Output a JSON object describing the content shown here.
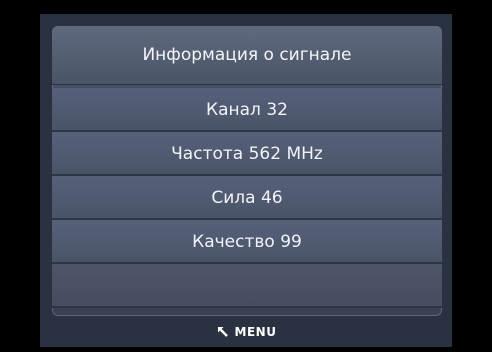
{
  "dialog": {
    "title": "Информация о сигнале"
  },
  "signal_info": {
    "items": [
      {
        "label": "Канал 32"
      },
      {
        "label": "Частота 562 MHz"
      },
      {
        "label": "Сила 46"
      },
      {
        "label": "Качество 99"
      }
    ]
  },
  "footer": {
    "menu_label": "MENU",
    "icon": "return-arrow-icon"
  }
}
